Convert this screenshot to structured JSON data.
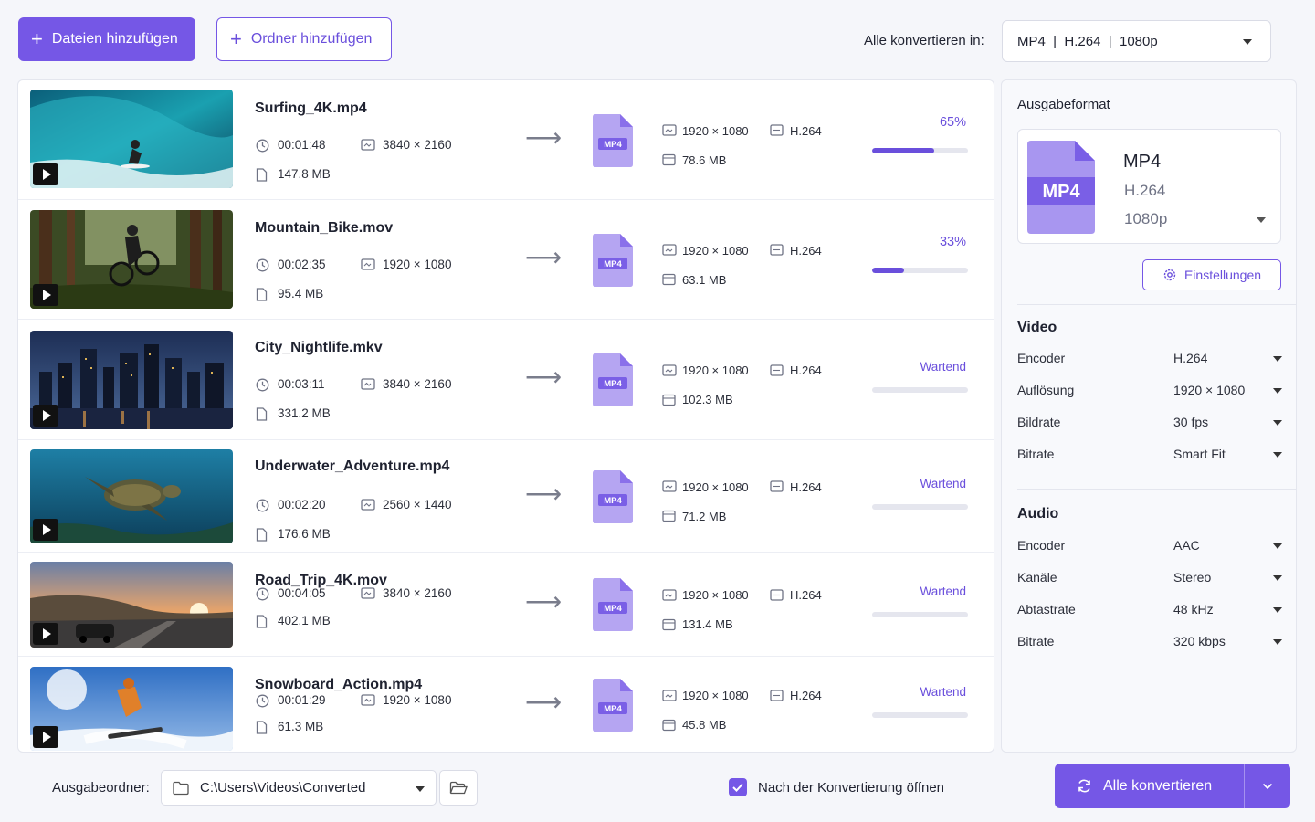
{
  "toolbar": {
    "add_files": "Dateien hinzufügen",
    "add_folder": "Ordner hinzufügen",
    "convert_all_to_label": "Alle konvertieren in:",
    "convert_all_to_value": "MP4  |  H.264  |  1080p"
  },
  "files": [
    {
      "name": "Surfing_4K.mp4",
      "duration": "00:01:48",
      "resolution": "3840 × 2160",
      "size": "147.8 MB",
      "out_resolution": "1920 × 1080",
      "out_codec": "H.264",
      "out_size": "78.6 MB",
      "status": "65%",
      "progress": 0.65,
      "format_badge": "MP4",
      "scene": "surf"
    },
    {
      "name": "Mountain_Bike.mov",
      "duration": "00:02:35",
      "resolution": "1920 × 1080",
      "size": "95.4 MB",
      "out_resolution": "1920 × 1080",
      "out_codec": "H.264",
      "out_size": "63.1 MB",
      "status": "33%",
      "progress": 0.33,
      "format_badge": "MP4",
      "scene": "forest"
    },
    {
      "name": "City_Nightlife.mkv",
      "duration": "00:03:11",
      "resolution": "3840 × 2160",
      "size": "331.2 MB",
      "out_resolution": "1920 × 1080",
      "out_codec": "H.264",
      "out_size": "102.3 MB",
      "status": "Wartend",
      "progress": 0,
      "format_badge": "MP4",
      "scene": "city"
    },
    {
      "name": "Underwater_Adventure.mp4",
      "duration": "00:02:20",
      "resolution": "2560 × 1440",
      "size": "176.6 MB",
      "out_resolution": "1920 × 1080",
      "out_codec": "H.264",
      "out_size": "71.2 MB",
      "status": "Wartend",
      "progress": 0,
      "format_badge": "MP4",
      "scene": "underwater"
    },
    {
      "name": "Road_Trip_4K.mov",
      "duration": "00:04:05",
      "resolution": "3840 × 2160",
      "size": "402.1 MB",
      "out_resolution": "1920 × 1080",
      "out_codec": "H.264",
      "out_size": "131.4 MB",
      "status": "Wartend",
      "progress": 0,
      "format_badge": "MP4",
      "scene": "road"
    },
    {
      "name": "Snowboard_Action.mp4",
      "duration": "00:01:29",
      "resolution": "1920 × 1080",
      "size": "61.3 MB",
      "out_resolution": "1920 × 1080",
      "out_codec": "H.264",
      "out_size": "45.8 MB",
      "status": "Wartend",
      "progress": 0,
      "format_badge": "MP4",
      "scene": "snow"
    }
  ],
  "sidebar": {
    "title": "Ausgabeformat",
    "format_badge": "MP4",
    "format_name": "MP4",
    "format_codec": "H.264",
    "format_res": "1080p",
    "settings_label": "Einstellungen",
    "video_title": "Video",
    "video": [
      {
        "label": "Encoder",
        "value": "H.264"
      },
      {
        "label": "Auflösung",
        "value": "1920 × 1080"
      },
      {
        "label": "Bildrate",
        "value": "30 fps"
      },
      {
        "label": "Bitrate",
        "value": "Smart Fit"
      }
    ],
    "audio_title": "Audio",
    "audio": [
      {
        "label": "Encoder",
        "value": "AAC"
      },
      {
        "label": "Kanäle",
        "value": "Stereo"
      },
      {
        "label": "Abtastrate",
        "value": "48 kHz"
      },
      {
        "label": "Bitrate",
        "value": "320 kbps"
      }
    ]
  },
  "footer": {
    "output_label": "Ausgabeordner:",
    "output_path": "C:\\Users\\Videos\\Converted",
    "open_after": "Nach der Konvertierung öffnen",
    "open_after_checked": true,
    "convert_all": "Alle konvertieren"
  },
  "colors": {
    "accent": "#7557e6",
    "progress": "#6a4fdc",
    "track": "#e5e6ee"
  },
  "icons": [
    "plus-icon",
    "clock-icon",
    "resolution-icon",
    "file-icon",
    "arrow-right-icon",
    "mp4-file-icon",
    "codec-icon",
    "gear-icon",
    "folder-icon",
    "folder-open-icon",
    "checkmark-icon",
    "refresh-icon",
    "chevron-down-icon",
    "play-icon"
  ]
}
